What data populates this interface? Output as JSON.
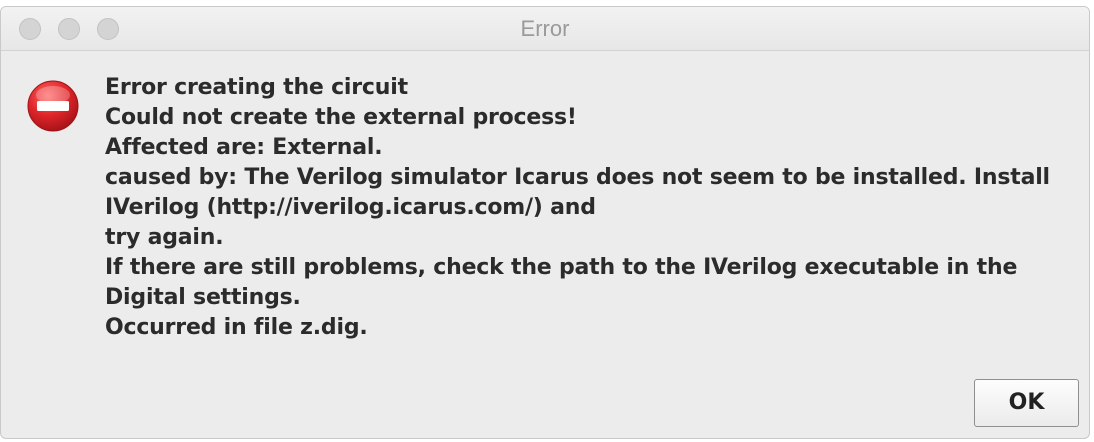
{
  "window": {
    "title": "Error"
  },
  "dialog": {
    "icon": "error-stop-icon",
    "message_lines": [
      "Error creating the circuit",
      "Could not create the external process!",
      "Affected are: External.",
      "caused by: The Verilog simulator Icarus does not seem to be installed. Install",
      "IVerilog (http://iverilog.icarus.com/) and",
      "try again.",
      "If there are still problems, check the path to the IVerilog executable in the",
      "Digital settings.",
      "Occurred in file z.dig."
    ],
    "ok_label": "OK"
  },
  "colors": {
    "dialog_bg": "#ececec",
    "icon_red": "#e0262a",
    "text": "#2b2b2b",
    "title_text": "#9a9a9a"
  }
}
